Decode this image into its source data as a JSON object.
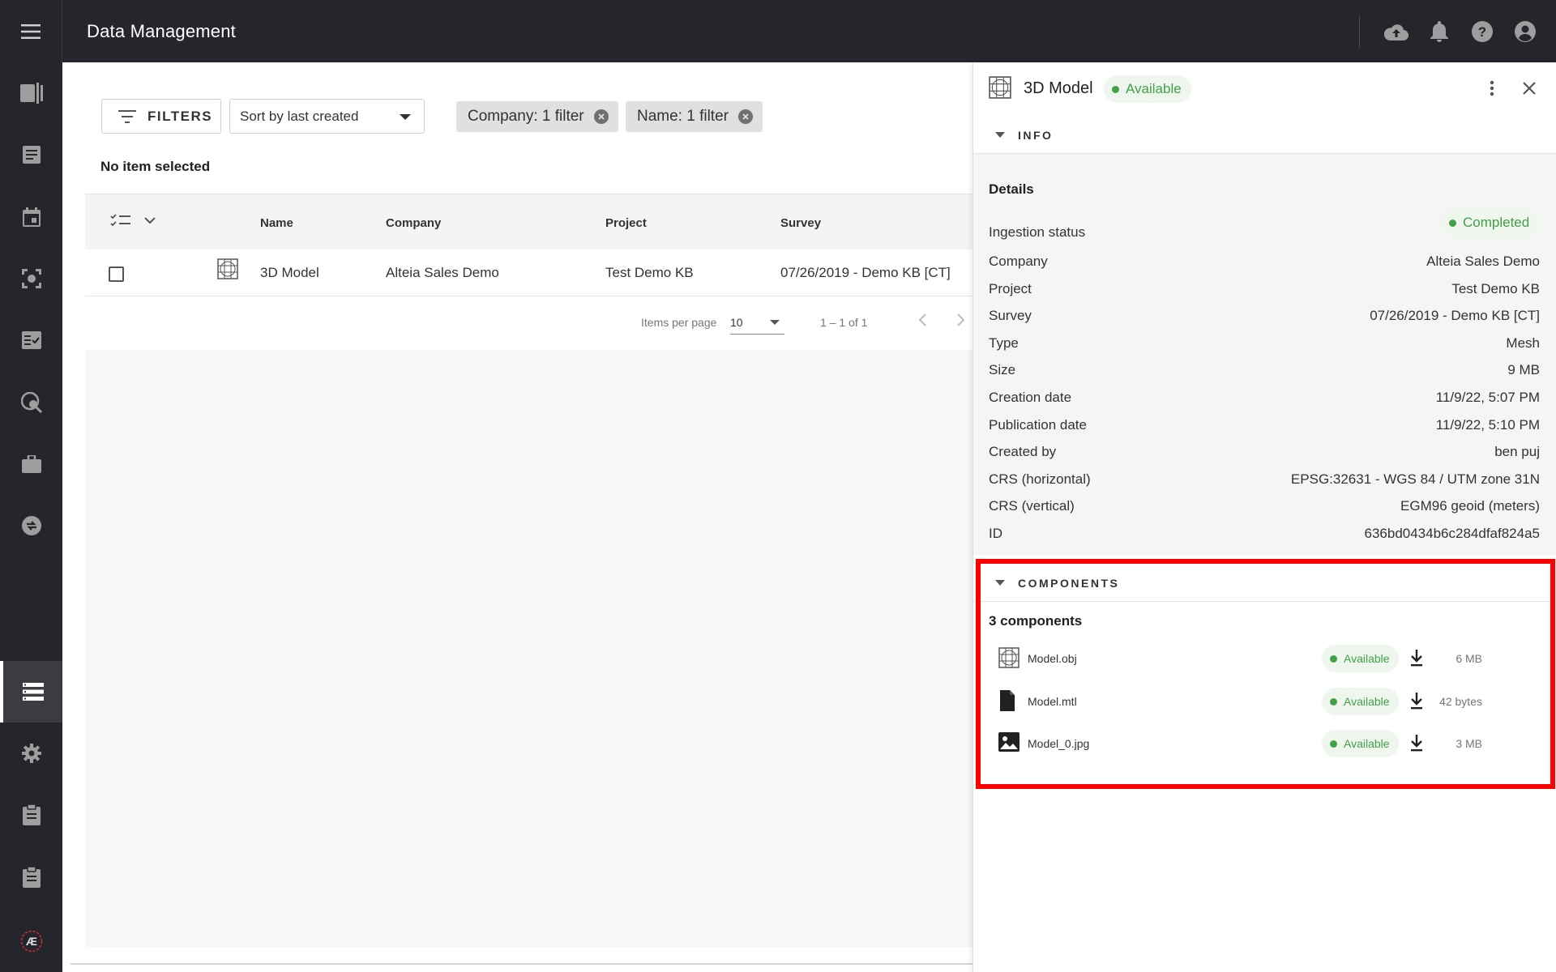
{
  "topbar": {
    "title": "Data Management",
    "icons": [
      "cloud-upload-icon",
      "bell-icon",
      "help-icon",
      "account-icon"
    ]
  },
  "rail": {
    "items": [
      "book-icon",
      "report-icon",
      "calendar-icon",
      "scan-icon",
      "checklist-icon",
      "search-globe-icon",
      "briefcase-icon",
      "sync-icon",
      "storage-icon",
      "gear-icon",
      "clipboard-icon",
      "clipboard-icon",
      "logo-icon"
    ],
    "active": "storage-icon",
    "logo_text": "Æ"
  },
  "toolbar": {
    "filters_label": "FILTERS",
    "sort_value": "Sort by last created",
    "chips": [
      "Company: 1 filter",
      "Name: 1 filter"
    ]
  },
  "selection_text": "No item selected",
  "table": {
    "columns": [
      "Name",
      "Company",
      "Project",
      "Survey"
    ],
    "rows": [
      {
        "name": "3D Model",
        "company": "Alteia Sales Demo",
        "project": "Test Demo KB",
        "survey": "07/26/2019 - Demo KB [CT]"
      }
    ]
  },
  "paginator": {
    "per_page_label": "Items per page",
    "per_page_value": "10",
    "range": "1 – 1 of 1"
  },
  "panel": {
    "title": "3D Model",
    "status": "Available",
    "info_section": "INFO",
    "details_title": "Details",
    "ingestion_label": "Ingestion status",
    "ingestion_status": "Completed",
    "details": [
      {
        "key": "Company",
        "value": "Alteia Sales Demo"
      },
      {
        "key": "Project",
        "value": "Test Demo KB"
      },
      {
        "key": "Survey",
        "value": "07/26/2019 - Demo KB [CT]"
      },
      {
        "key": "Type",
        "value": "Mesh"
      },
      {
        "key": "Size",
        "value": "9 MB"
      },
      {
        "key": "Creation date",
        "value": "11/9/22, 5:07 PM"
      },
      {
        "key": "Publication date",
        "value": "11/9/22, 5:10 PM"
      },
      {
        "key": "Created by",
        "value": "ben puj"
      },
      {
        "key": "CRS (horizontal)",
        "value": "EPSG:32631 - WGS 84 / UTM zone 31N"
      },
      {
        "key": "CRS (vertical)",
        "value": "EGM96 geoid (meters)"
      },
      {
        "key": "ID",
        "value": "636bd0434b6c284dfaf824a5"
      }
    ],
    "components_section": "COMPONENTS",
    "components_count": "3 components",
    "components": [
      {
        "icon": "mesh-icon",
        "name": "Model.obj",
        "status": "Available",
        "size": "6 MB"
      },
      {
        "icon": "file-icon",
        "name": "Model.mtl",
        "status": "Available",
        "size": "42 bytes"
      },
      {
        "icon": "image-icon",
        "name": "Model_0.jpg",
        "status": "Available",
        "size": "3 MB"
      }
    ]
  },
  "colors": {
    "topbar_bg": "#25262b",
    "status_green": "#43a047",
    "highlight_red": "#ff0000"
  }
}
